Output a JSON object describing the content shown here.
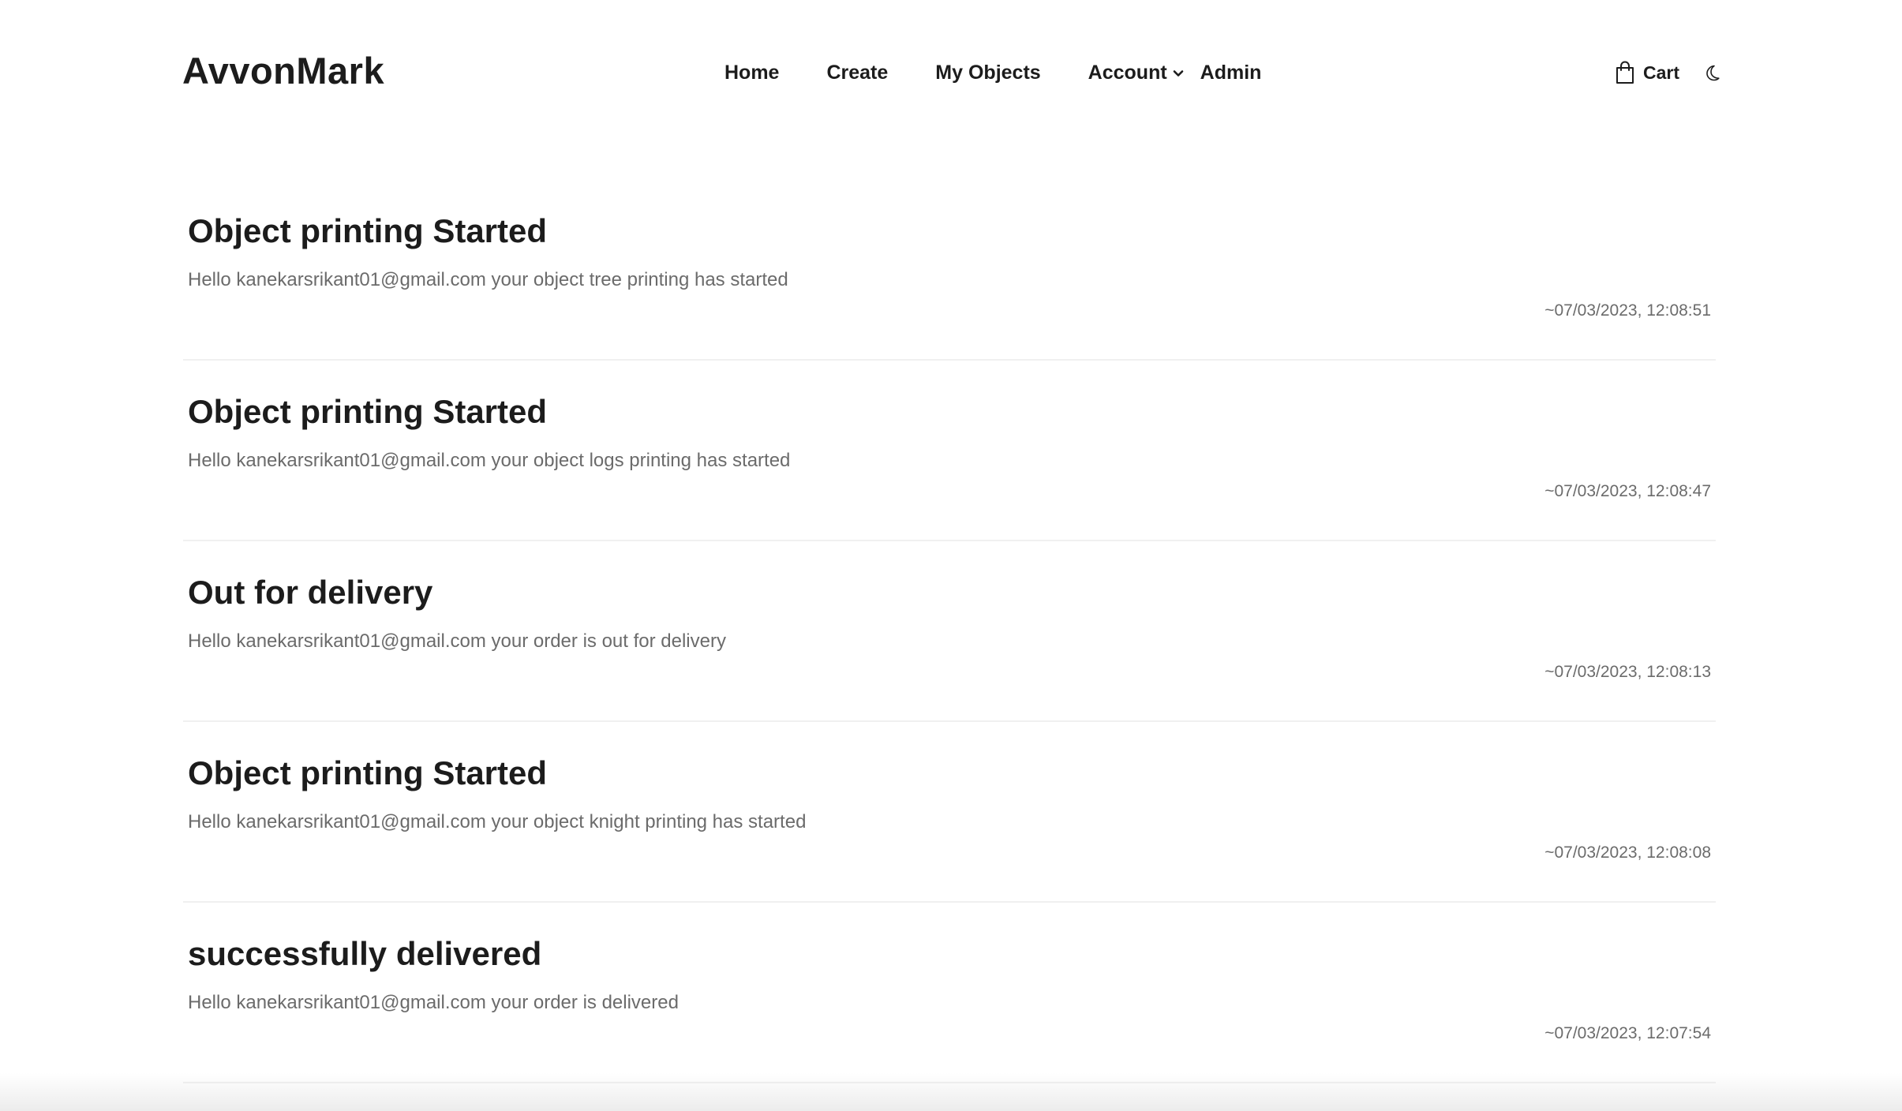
{
  "brand": {
    "name": "AvvonMark"
  },
  "nav": {
    "items": [
      {
        "label": "Home"
      },
      {
        "label": "Create"
      },
      {
        "label": "My Objects"
      },
      {
        "label": "Account"
      },
      {
        "label": "Admin"
      }
    ]
  },
  "toolbar": {
    "cart_label": "Cart",
    "cart_icon": "shopping-bag-icon",
    "theme_icon": "moon-icon"
  },
  "notifications": [
    {
      "title": "Object printing Started",
      "message": "Hello kanekarsrikant01@gmail.com your object tree printing has started",
      "time": "~07/03/2023, 12:08:51"
    },
    {
      "title": "Object printing Started",
      "message": "Hello kanekarsrikant01@gmail.com your object logs printing has started",
      "time": "~07/03/2023, 12:08:47"
    },
    {
      "title": "Out for delivery",
      "message": "Hello kanekarsrikant01@gmail.com your order is out for delivery",
      "time": "~07/03/2023, 12:08:13"
    },
    {
      "title": "Object printing Started",
      "message": "Hello kanekarsrikant01@gmail.com your object knight printing has started",
      "time": "~07/03/2023, 12:08:08"
    },
    {
      "title": "successfully delivered",
      "message": "Hello kanekarsrikant01@gmail.com your order is delivered",
      "time": "~07/03/2023, 12:07:54"
    }
  ],
  "colors": {
    "text_primary": "#1c1c1c",
    "text_secondary": "#6b6b6b",
    "divider": "#f0f0f0",
    "background": "#ffffff"
  }
}
